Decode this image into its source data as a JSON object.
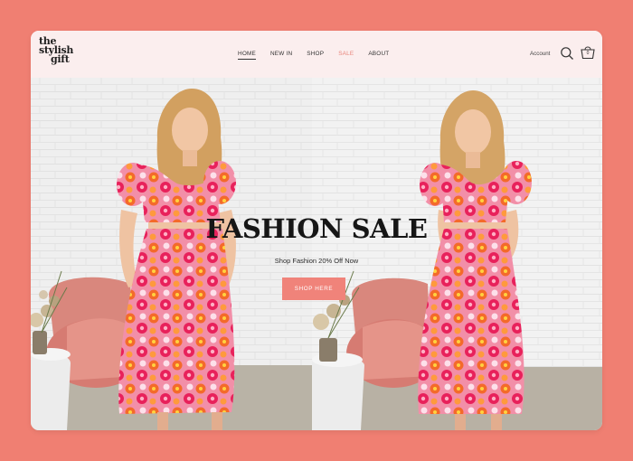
{
  "brand": {
    "logo_lines": [
      "the",
      "stylish",
      "gift"
    ]
  },
  "nav": [
    {
      "label": "HOME",
      "active": true
    },
    {
      "label": "NEW IN"
    },
    {
      "label": "SHOP"
    },
    {
      "label": "SALE",
      "highlight": true
    },
    {
      "label": "ABOUT"
    }
  ],
  "header": {
    "account_label": "Account",
    "cart_count": "0"
  },
  "hero": {
    "title": "FASHION SALE",
    "subtitle": "Shop Fashion 20% Off Now",
    "button_label": "SHOP HERE"
  },
  "colors": {
    "page_background": "#f07f72",
    "header_background": "#fbeeee",
    "accent": "#f0837a",
    "sale_link": "#e8847a"
  },
  "icons": [
    "search-icon",
    "cart-icon"
  ]
}
